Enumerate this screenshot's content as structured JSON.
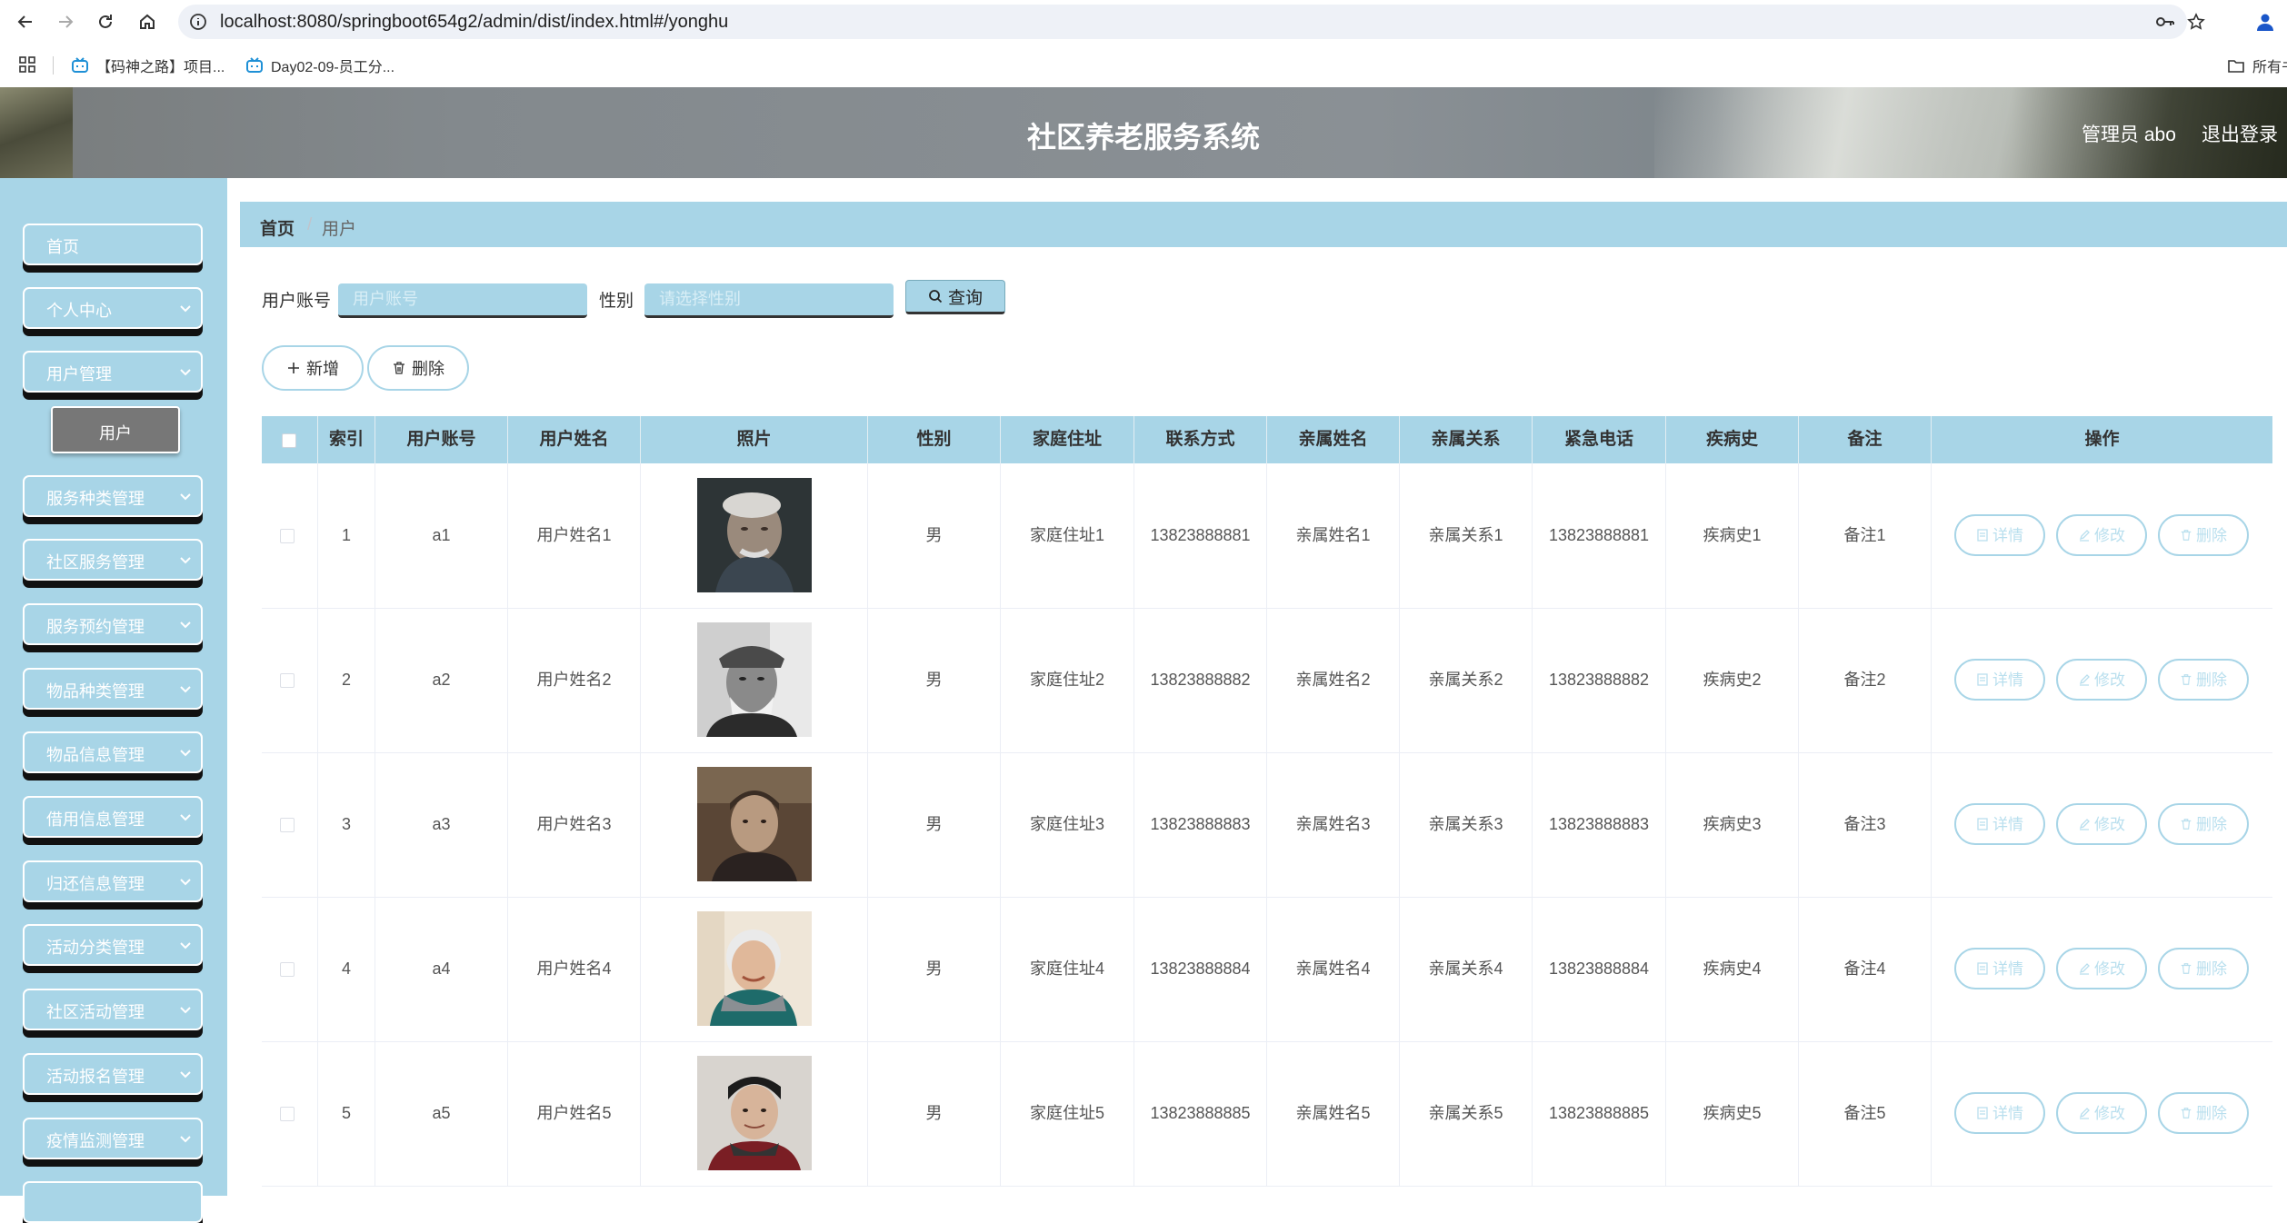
{
  "browser": {
    "url": "localhost:8080/springboot654g2/admin/dist/index.html#/yonghu",
    "bookmarks": [
      "【码神之路】项目...",
      "Day02-09-员工分..."
    ],
    "all_bookmarks_label": "所有书"
  },
  "header": {
    "title": "社区养老服务系统",
    "user_label": "管理员 abo",
    "logout_label": "退出登录"
  },
  "sidebar": {
    "items": [
      {
        "label": "首页",
        "has_children": false
      },
      {
        "label": "个人中心",
        "has_children": true
      },
      {
        "label": "用户管理",
        "has_children": true
      },
      {
        "label": "服务种类管理",
        "has_children": true
      },
      {
        "label": "社区服务管理",
        "has_children": true
      },
      {
        "label": "服务预约管理",
        "has_children": true
      },
      {
        "label": "物品种类管理",
        "has_children": true
      },
      {
        "label": "物品信息管理",
        "has_children": true
      },
      {
        "label": "借用信息管理",
        "has_children": true
      },
      {
        "label": "归还信息管理",
        "has_children": true
      },
      {
        "label": "活动分类管理",
        "has_children": true
      },
      {
        "label": "社区活动管理",
        "has_children": true
      },
      {
        "label": "活动报名管理",
        "has_children": true
      },
      {
        "label": "疫情监测管理",
        "has_children": true
      }
    ],
    "active_submenu": "用户"
  },
  "breadcrumb": {
    "home": "首页",
    "separator": "/",
    "current": "用户"
  },
  "search": {
    "account_label": "用户账号",
    "account_placeholder": "用户账号",
    "gender_label": "性别",
    "gender_placeholder": "请选择性别",
    "query_label": "查询"
  },
  "actions": {
    "add_label": "新增",
    "delete_label": "删除"
  },
  "table": {
    "columns": [
      "",
      "索引",
      "用户账号",
      "用户姓名",
      "照片",
      "性别",
      "家庭住址",
      "联系方式",
      "亲属姓名",
      "亲属关系",
      "紧急电话",
      "疾病史",
      "备注",
      "操作"
    ],
    "row_buttons": {
      "detail": "详情",
      "edit": "修改",
      "delete": "删除"
    },
    "rows": [
      {
        "index": "1",
        "account": "a1",
        "name": "用户姓名1",
        "gender": "男",
        "address": "家庭住址1",
        "phone": "13823888881",
        "relative_name": "亲属姓名1",
        "relation": "亲属关系1",
        "emergency": "13823888881",
        "history": "疾病史1",
        "note": "备注1"
      },
      {
        "index": "2",
        "account": "a2",
        "name": "用户姓名2",
        "gender": "男",
        "address": "家庭住址2",
        "phone": "13823888882",
        "relative_name": "亲属姓名2",
        "relation": "亲属关系2",
        "emergency": "13823888882",
        "history": "疾病史2",
        "note": "备注2"
      },
      {
        "index": "3",
        "account": "a3",
        "name": "用户姓名3",
        "gender": "男",
        "address": "家庭住址3",
        "phone": "13823888883",
        "relative_name": "亲属姓名3",
        "relation": "亲属关系3",
        "emergency": "13823888883",
        "history": "疾病史3",
        "note": "备注3"
      },
      {
        "index": "4",
        "account": "a4",
        "name": "用户姓名4",
        "gender": "男",
        "address": "家庭住址4",
        "phone": "13823888884",
        "relative_name": "亲属姓名4",
        "relation": "亲属关系4",
        "emergency": "13823888884",
        "history": "疾病史4",
        "note": "备注4"
      },
      {
        "index": "5",
        "account": "a5",
        "name": "用户姓名5",
        "gender": "男",
        "address": "家庭住址5",
        "phone": "13823888885",
        "relative_name": "亲属姓名5",
        "relation": "亲属关系5",
        "emergency": "13823888885",
        "history": "疾病史5",
        "note": "备注5"
      }
    ]
  },
  "colors": {
    "accent": "#a8d5e7",
    "header_overlay": "#8a9095"
  }
}
